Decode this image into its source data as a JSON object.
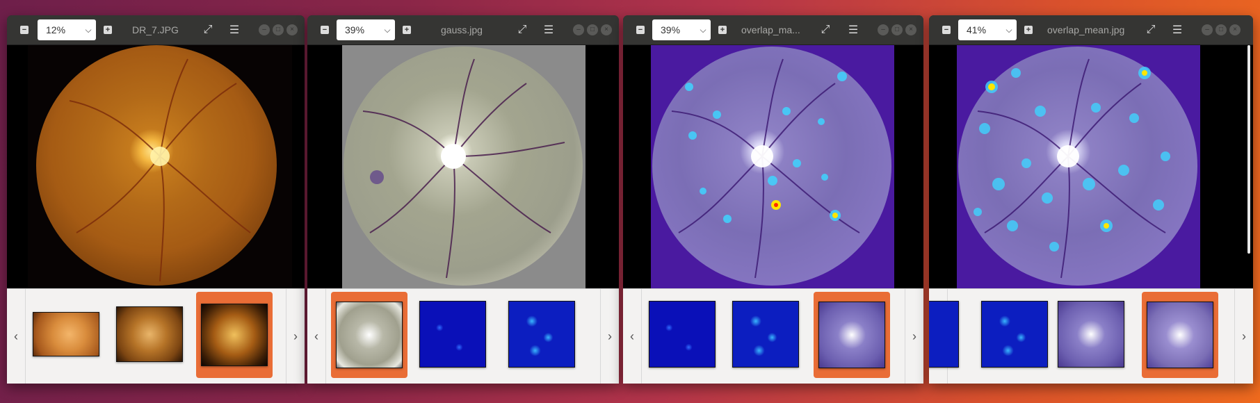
{
  "windows": [
    {
      "zoom": "12%",
      "title": "DR_7.JPG",
      "image_kind": "fundus-orange",
      "thumbnails": [
        {
          "kind": "fundus-light",
          "selected": false
        },
        {
          "kind": "fundus-orange",
          "selected": false
        },
        {
          "kind": "fundus-dark",
          "selected": true
        }
      ]
    },
    {
      "zoom": "39%",
      "title": "gauss.jpg",
      "image_kind": "fundus-gauss",
      "thumbnails": [
        {
          "kind": "fundus-gauss",
          "selected": true
        },
        {
          "kind": "heatmap-sparse",
          "selected": false
        },
        {
          "kind": "heatmap-dense",
          "selected": false
        }
      ]
    },
    {
      "zoom": "39%",
      "title": "overlap_ma...",
      "image_kind": "fundus-overlap-max",
      "thumbnails": [
        {
          "kind": "heatmap-sparse",
          "selected": false
        },
        {
          "kind": "heatmap-dense",
          "selected": false
        },
        {
          "kind": "fundus-overlap",
          "selected": true
        }
      ]
    },
    {
      "zoom": "41%",
      "title": "overlap_mean.jpg",
      "image_kind": "fundus-overlap-mean",
      "thumbnails": [
        {
          "kind": "heatmap-dense",
          "selected": false
        },
        {
          "kind": "fundus-overlap",
          "selected": false
        },
        {
          "kind": "fundus-overlap",
          "selected": true
        }
      ]
    }
  ],
  "icons": {
    "zoom_out": "minus-icon",
    "zoom_in": "plus-icon",
    "fullscreen": "expand-icon",
    "menu": "hamburger-menu-icon",
    "minimize": "minimize-icon",
    "maximize": "maximize-icon",
    "close": "close-icon",
    "prev": "chevron-left-icon",
    "next": "chevron-right-icon",
    "dropdown": "chevron-down-icon"
  },
  "colors": {
    "accent_selected": "#e96d36",
    "titlebar": "#353533"
  }
}
